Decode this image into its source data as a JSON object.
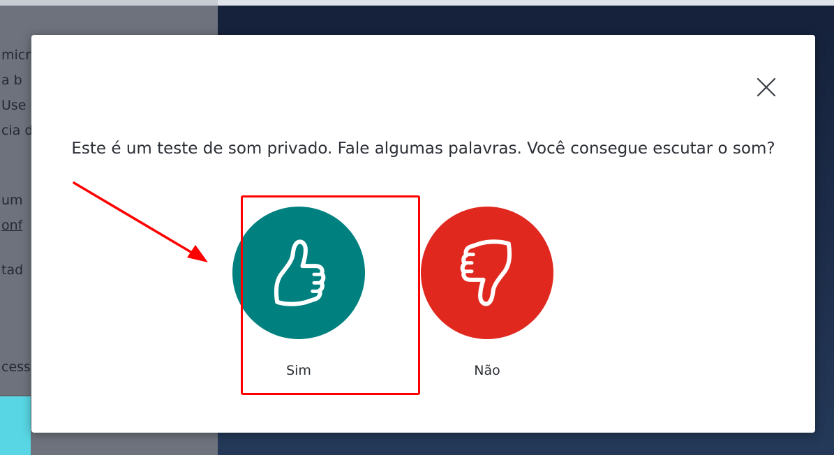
{
  "background": {
    "left_panel_lines": [
      "micr",
      "a b",
      "Use",
      "cia d",
      "um",
      "onf",
      "tad",
      "cess"
    ]
  },
  "dialog": {
    "close_icon": "close-icon",
    "prompt": "Este é um teste de som privado. Fale algumas palavras. Você consegue escutar o som?",
    "options": [
      {
        "label": "Sim",
        "icon": "thumbs-up-icon",
        "color": "#00807f"
      },
      {
        "label": "Não",
        "icon": "thumbs-down-icon",
        "color": "#e0281f"
      }
    ]
  },
  "annotation": {
    "highlight_color": "#ff0000",
    "target": "Sim"
  }
}
